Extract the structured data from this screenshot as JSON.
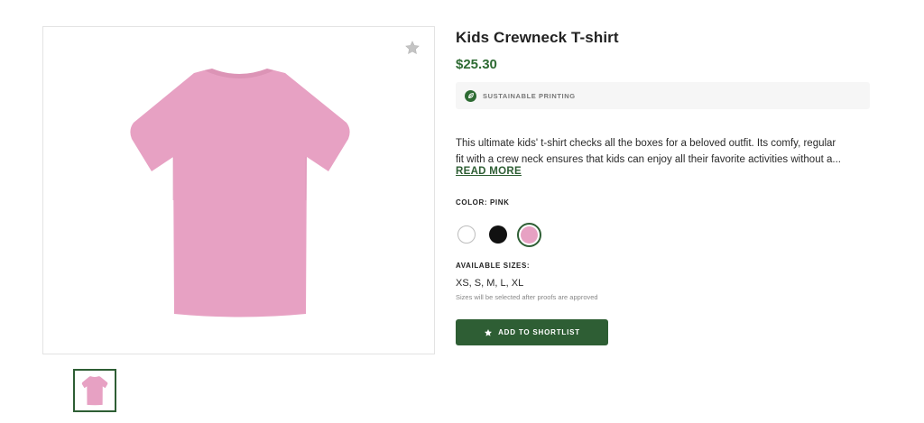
{
  "product": {
    "title": "Kids Crewneck T-shirt",
    "price": "$25.30",
    "badge": {
      "icon": "leaf-icon",
      "label": "SUSTAINABLE PRINTING"
    },
    "description_lines": [
      "This ultimate kids' t-shirt checks all the boxes for a beloved outfit. Its comfy, regular",
      "fit with a crew neck ensures that kids can enjoy all their favorite activities without a..."
    ],
    "read_more": "READ MORE",
    "color_label": "COLOR: PINK",
    "colors": [
      {
        "name": "white",
        "hex": "#ffffff",
        "selected": false
      },
      {
        "name": "black",
        "hex": "#111111",
        "selected": false
      },
      {
        "name": "pink",
        "hex": "#e7a1c3",
        "selected": true
      }
    ],
    "sizes_label": "AVAILABLE SIZES:",
    "sizes": "XS, S, M, L, XL",
    "sizes_note": "Sizes will be selected after proofs are approved",
    "shortlist_button": {
      "icon": "star-icon",
      "label": "ADD TO SHORTLIST"
    },
    "favorite_icon": "star-icon",
    "shirt_color": "#e7a1c3",
    "accent_color": "#2e5e34",
    "price_color": "#2e6b33"
  }
}
